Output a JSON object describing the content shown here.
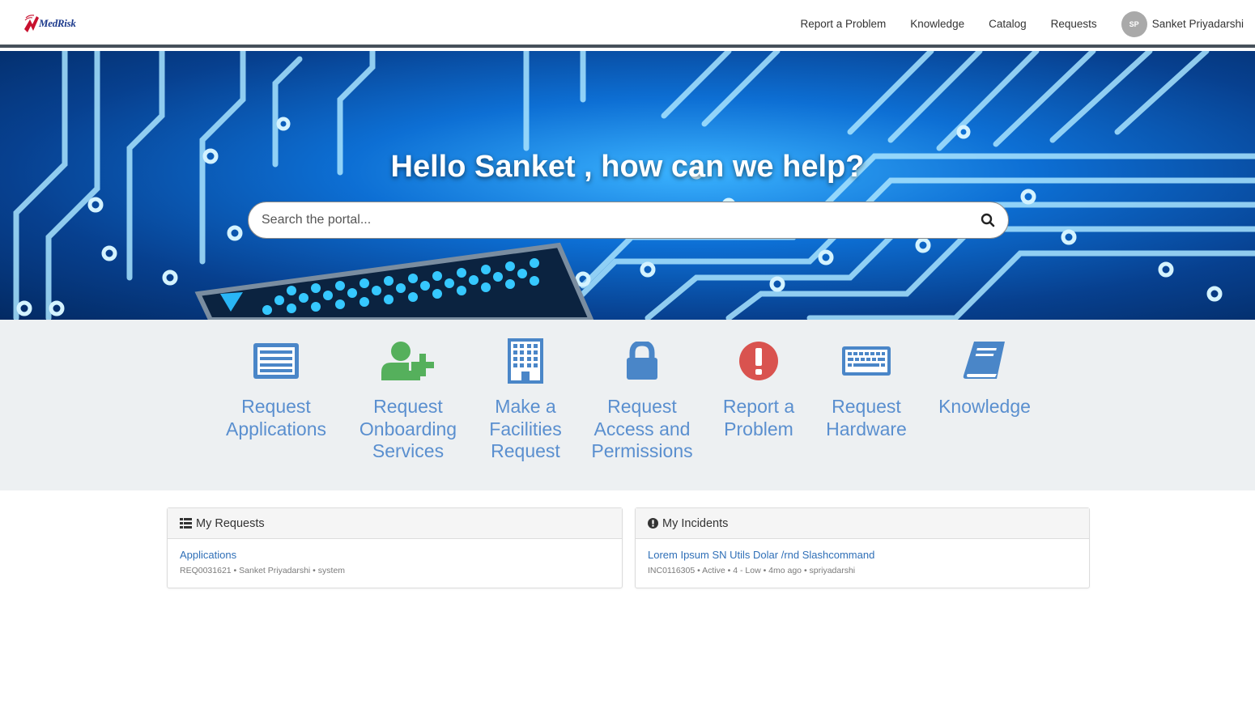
{
  "header": {
    "logo_text": "MedRisk",
    "nav": [
      "Report a Problem",
      "Knowledge",
      "Catalog",
      "Requests"
    ],
    "user": {
      "initials": "SP",
      "name": "Sanket Priyadarshi"
    }
  },
  "hero": {
    "title": "Hello Sanket , how can we help?",
    "search_placeholder": "Search the portal..."
  },
  "quick_links": [
    {
      "icon": "list-icon",
      "lines": [
        "Request",
        "Applications"
      ],
      "color": "#4a86c8"
    },
    {
      "icon": "user-plus-icon",
      "lines": [
        "Request",
        "Onboarding",
        "Services"
      ],
      "color": "#55b05c"
    },
    {
      "icon": "building-icon",
      "lines": [
        "Make a",
        "Facilities",
        "Request"
      ],
      "color": "#4a86c8"
    },
    {
      "icon": "lock-icon",
      "lines": [
        "Request",
        "Access and",
        "Permissions"
      ],
      "color": "#4a86c8"
    },
    {
      "icon": "exclamation-circle-icon",
      "lines": [
        "Report a",
        "Problem"
      ],
      "color": "#d9534f"
    },
    {
      "icon": "keyboard-icon",
      "lines": [
        "Request",
        "Hardware"
      ],
      "color": "#4a86c8"
    },
    {
      "icon": "book-icon",
      "lines": [
        "Knowledge"
      ],
      "color": "#4a86c8"
    }
  ],
  "panels": {
    "requests": {
      "title": "My Requests",
      "items": [
        {
          "title": "Applications",
          "meta": "REQ0031621 • Sanket Priyadarshi • system"
        }
      ]
    },
    "incidents": {
      "title": "My Incidents",
      "items": [
        {
          "title": "Lorem Ipsum SN Utils Dolar /rnd Slashcommand",
          "meta": "INC0116305 • Active • 4 - Low • 4mo ago • spriyadarshi"
        }
      ]
    }
  }
}
